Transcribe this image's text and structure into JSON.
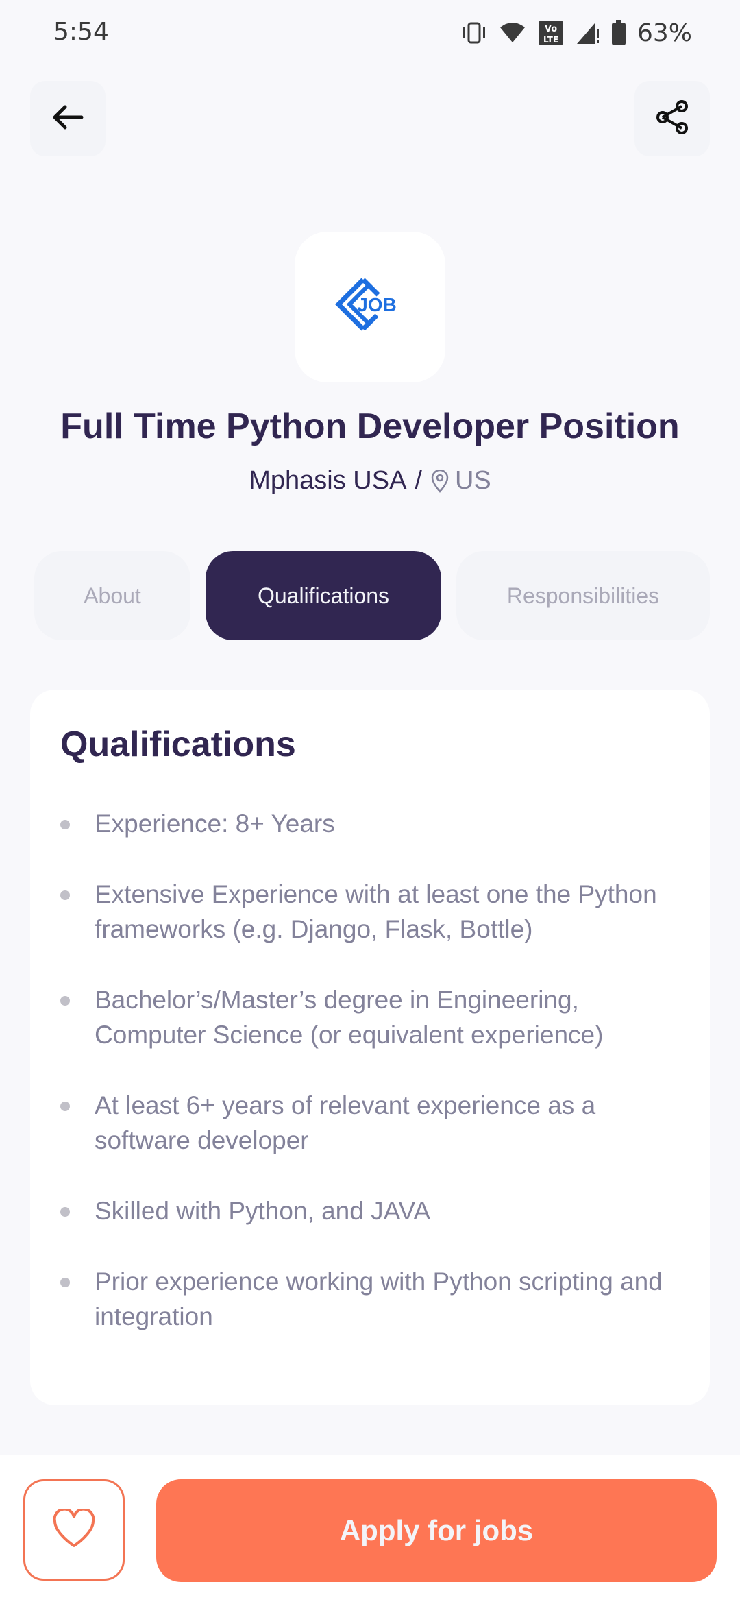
{
  "status_bar": {
    "time": "5:54",
    "battery": "63%",
    "icons": [
      "vibrate-icon",
      "wifi-icon",
      "volte-icon",
      "signal-icon",
      "battery-icon"
    ]
  },
  "header": {
    "back_icon": "arrow-left-icon",
    "share_icon": "share-icon"
  },
  "job": {
    "logo_text": "JOB",
    "title": "Full Time Python Developer Position",
    "company": "Mphasis USA",
    "separator": "/",
    "location": "US"
  },
  "tabs": [
    {
      "label": "About",
      "active": false
    },
    {
      "label": "Qualifications",
      "active": true
    },
    {
      "label": "Responsibilities",
      "active": false
    }
  ],
  "qualifications": {
    "heading": "Qualifications",
    "items": [
      "Experience: 8+ Years",
      "Extensive Experience with at least one the Python frameworks (e.g. Django, Flask, Bottle)",
      "Bachelor’s/Master’s degree in Engineering, Computer Science (or equivalent experience)",
      "At least 6+ years of relevant experience as a software developer",
      "Skilled with Python, and JAVA",
      "Prior experience working with Python scripting and integration"
    ]
  },
  "footer": {
    "like_icon": "heart-icon",
    "apply_label": "Apply for jobs"
  },
  "colors": {
    "primary": "#312651",
    "accent": "#FE7654",
    "gray": "#83829A",
    "background": "#F8F8FB",
    "logo_blue": "#1E6FE0"
  }
}
